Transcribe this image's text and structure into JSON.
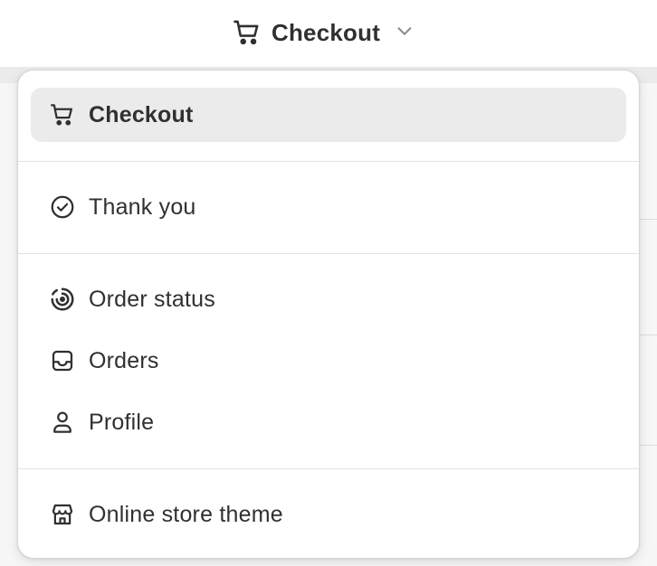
{
  "header": {
    "page_selector_label": "Checkout",
    "page_selector_icon": "cart-icon",
    "dropdown_icon": "chevron-down-icon"
  },
  "menu": {
    "groups": [
      {
        "items": [
          {
            "label": "Checkout",
            "icon": "cart-icon",
            "selected": true
          }
        ]
      },
      {
        "items": [
          {
            "label": "Thank you",
            "icon": "check-circle-icon",
            "selected": false
          }
        ]
      },
      {
        "items": [
          {
            "label": "Order status",
            "icon": "order-status-icon",
            "selected": false
          },
          {
            "label": "Orders",
            "icon": "inbox-icon",
            "selected": false
          },
          {
            "label": "Profile",
            "icon": "person-icon",
            "selected": false
          }
        ]
      },
      {
        "items": [
          {
            "label": "Online store theme",
            "icon": "store-icon",
            "selected": false
          }
        ]
      }
    ]
  },
  "colors": {
    "text": "#303030",
    "selected_bg": "#ebebeb",
    "divider": "#e3e3e3",
    "menu_bg": "#ffffff"
  }
}
